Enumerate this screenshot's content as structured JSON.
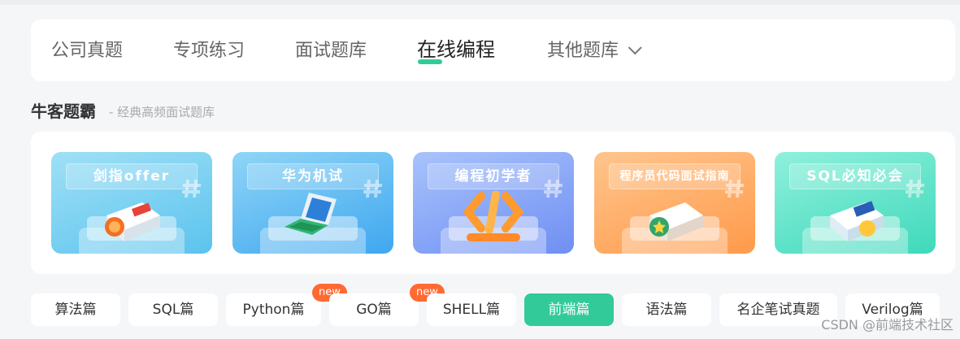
{
  "tabs": [
    {
      "label": "公司真题"
    },
    {
      "label": "专项练习"
    },
    {
      "label": "面试题库"
    },
    {
      "label": "在线编程"
    },
    {
      "label": "其他题库"
    }
  ],
  "section": {
    "title": "牛客题霸",
    "subtitle": "- 经典高频面试题库"
  },
  "banners": [
    {
      "label": "剑指offer",
      "icon": "book-icon"
    },
    {
      "label": "华为机试",
      "icon": "laptop-icon"
    },
    {
      "label": "编程初学者",
      "icon": "code-brackets-icon"
    },
    {
      "label": "程序员代码面试指南",
      "icon": "book-star-icon"
    },
    {
      "label": "SQL必知必会",
      "icon": "sql-book-icon"
    }
  ],
  "categories": [
    {
      "label": "算法篇"
    },
    {
      "label": "SQL篇"
    },
    {
      "label": "Python篇"
    },
    {
      "label": "GO篇"
    },
    {
      "label": "SHELL篇"
    },
    {
      "label": "前端篇"
    },
    {
      "label": "语法篇"
    },
    {
      "label": "名企笔试真题"
    },
    {
      "label": "Verilog篇"
    }
  ],
  "badges": {
    "python": "new",
    "go": "new"
  },
  "watermark": "CSDN @前端技术社区",
  "colors": {
    "accent": "#32ca99",
    "badge": "#ff6a33"
  }
}
